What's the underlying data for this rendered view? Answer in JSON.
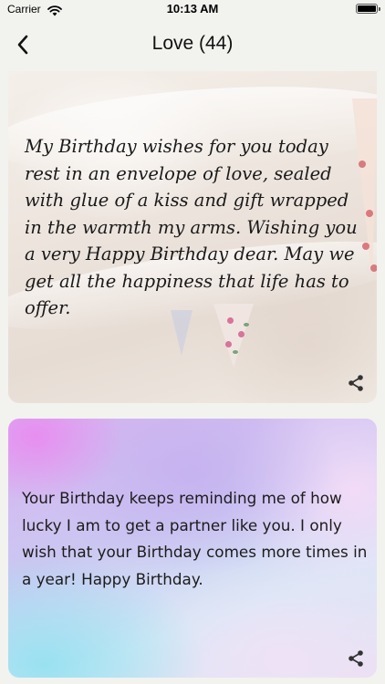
{
  "status_bar": {
    "carrier": "Carrier",
    "time": "10:13 AM"
  },
  "nav": {
    "title": "Love (44)",
    "back_icon": "chevron-left-icon"
  },
  "cards": [
    {
      "text": "My Birthday wishes for you today rest in an envelope of love, sealed with glue of a kiss and gift wrapped in the warmth my arms. Wishing you a very Happy Birthday dear. May we get all the happiness that life has to offer.",
      "background": "bunting-tent-photo",
      "share_icon": "share-icon"
    },
    {
      "text": "Your Birthday keeps reminding me of how lucky I am to get a partner like you. I only wish that your Birthday comes more times in a year! Happy Birthday.",
      "background": "pastel-gradient",
      "share_icon": "share-icon"
    }
  ],
  "colors": {
    "background": "#f2f2ef",
    "text": "#1a1a1a",
    "gradient_pink": "#e88cf0",
    "gradient_cyan": "#96e1f0"
  }
}
